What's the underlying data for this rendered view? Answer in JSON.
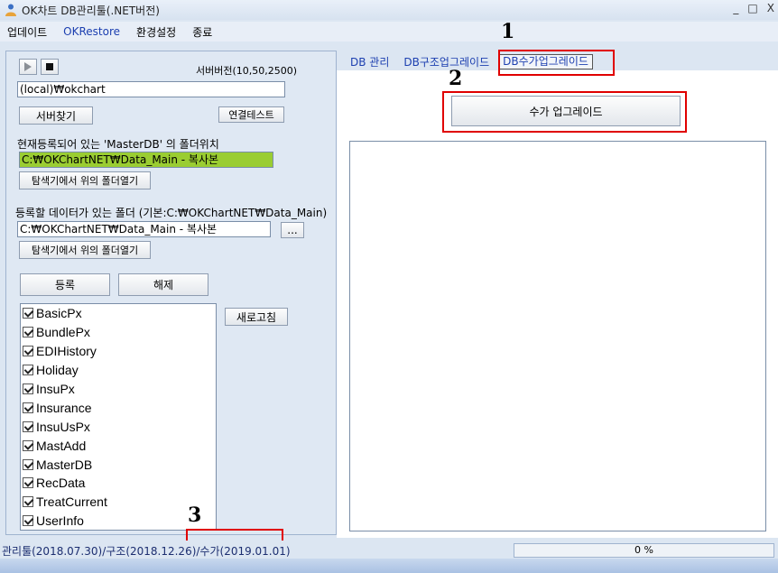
{
  "window": {
    "title": "OK차트 DB관리툴(.NET버전)",
    "minimize": "_",
    "maximize": "□",
    "close": "X"
  },
  "menu": {
    "items": [
      "업데이트",
      "OKRestore",
      "환경설정",
      "종료"
    ]
  },
  "left": {
    "play_icon": "play-icon",
    "stop_icon": "stop-icon",
    "server_version": "서버버전(10,50,2500)",
    "server_input": "(local)₩okchart",
    "find_server_button": "서버찾기",
    "connect_test_button": "연결테스트",
    "master_label": "현재등록되어 있는 'MasterDB' 의 폴더위치",
    "master_path": "C:₩OKChartNET₩Data_Main - 복사본",
    "open_folder_button1": "탐색기에서 위의 폴더열기",
    "data_label": "등록할 데이터가 있는 폴더 (기본:C:₩OKChartNET₩Data_Main)",
    "data_path": "C:₩OKChartNET₩Data_Main - 복사본",
    "browse_button": "...",
    "open_folder_button2": "탐색기에서 위의 폴더열기",
    "register_button": "등록",
    "unregister_button": "해제",
    "refresh_button": "새로고침",
    "tables": [
      {
        "name": "BasicPx",
        "checked": true
      },
      {
        "name": "BundlePx",
        "checked": true
      },
      {
        "name": "EDIHistory",
        "checked": true
      },
      {
        "name": "Holiday",
        "checked": true
      },
      {
        "name": "InsuPx",
        "checked": true
      },
      {
        "name": "Insurance",
        "checked": true
      },
      {
        "name": "InsuUsPx",
        "checked": true
      },
      {
        "name": "MastAdd",
        "checked": true
      },
      {
        "name": "MasterDB",
        "checked": true
      },
      {
        "name": "RecData",
        "checked": true
      },
      {
        "name": "TreatCurrent",
        "checked": true
      },
      {
        "name": "UserInfo",
        "checked": true
      }
    ]
  },
  "tabs": {
    "items": [
      "DB 관리",
      "DB구조업그레이드",
      "DB수가업그레이드"
    ],
    "active": "DB수가업그레이드"
  },
  "right": {
    "upgrade_button": "수가 업그레이드"
  },
  "annotations": {
    "n1": "1",
    "n2": "2",
    "n3": "3",
    "highlight_color": "#e00000"
  },
  "status": {
    "text": "관리툴(2018.07.30)/구조(2018.12.26)/수가(2019.01.01)",
    "progress": "0 %",
    "progress_value": 0
  }
}
